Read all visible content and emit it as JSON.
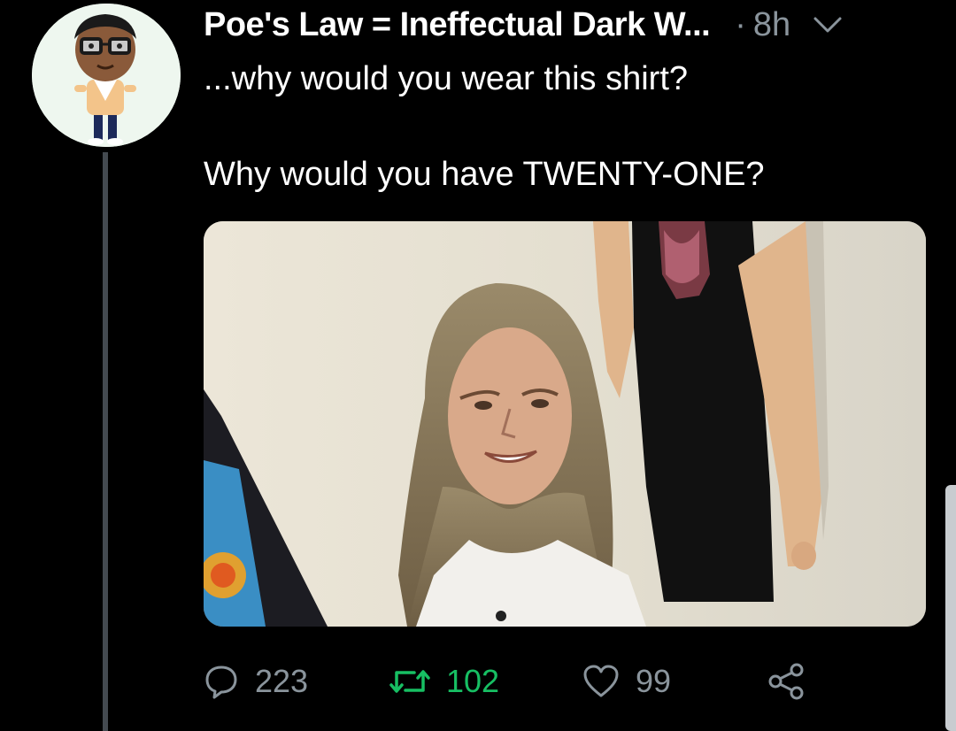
{
  "tweet": {
    "display_name": "Poe's Law = Ineffectual Dark W...",
    "separator": "·",
    "time": "8h",
    "text_line1": "...why would you wear this shirt?",
    "text_line2": "Why would you have TWENTY-ONE?",
    "actions": {
      "replies": "223",
      "retweets": "102",
      "likes": "99"
    }
  },
  "colors": {
    "background": "#000000",
    "text": "#ffffff",
    "muted": "#8a949c",
    "retweet": "#17bf63",
    "thread_line": "#444a50"
  },
  "icons": {
    "menu": "chevron-down-icon",
    "reply": "speech-bubble-icon",
    "retweet": "retweet-arrows-icon",
    "like": "heart-icon",
    "share": "share-nodes-icon"
  }
}
